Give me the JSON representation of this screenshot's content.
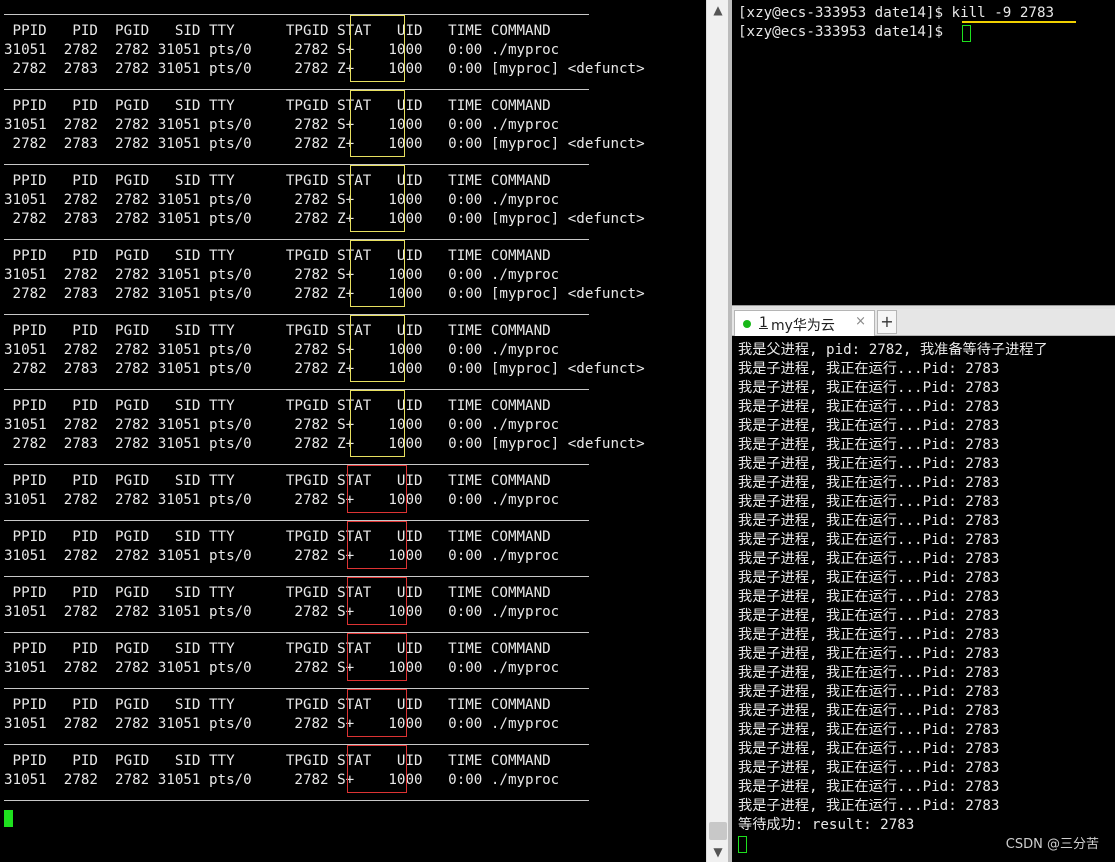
{
  "left_terminal": {
    "header": " PPID   PID  PGID   SID TTY      TPGID STAT   UID   TIME COMMAND",
    "blocks": [
      {
        "rows": [
          "31051  2782  2782 31051 pts/0     2782 S+    1000   0:00 ./myproc",
          " 2782  2783  2782 31051 pts/0     2782 Z+    1000   0:00 [myproc] <defunct>"
        ]
      },
      {
        "rows": [
          "31051  2782  2782 31051 pts/0     2782 S+    1000   0:00 ./myproc",
          " 2782  2783  2782 31051 pts/0     2782 Z+    1000   0:00 [myproc] <defunct>"
        ]
      },
      {
        "rows": [
          "31051  2782  2782 31051 pts/0     2782 S+    1000   0:00 ./myproc",
          " 2782  2783  2782 31051 pts/0     2782 Z+    1000   0:00 [myproc] <defunct>"
        ]
      },
      {
        "rows": [
          "31051  2782  2782 31051 pts/0     2782 S+    1000   0:00 ./myproc",
          " 2782  2783  2782 31051 pts/0     2782 Z+    1000   0:00 [myproc] <defunct>"
        ]
      },
      {
        "rows": [
          "31051  2782  2782 31051 pts/0     2782 S+    1000   0:00 ./myproc",
          " 2782  2783  2782 31051 pts/0     2782 Z+    1000   0:00 [myproc] <defunct>"
        ]
      },
      {
        "rows": [
          "31051  2782  2782 31051 pts/0     2782 S+    1000   0:00 ./myproc",
          " 2782  2783  2782 31051 pts/0     2782 Z+    1000   0:00 [myproc] <defunct>"
        ]
      },
      {
        "rows": [
          "31051  2782  2782 31051 pts/0     2782 S+    1000   0:00 ./myproc"
        ]
      },
      {
        "rows": [
          "31051  2782  2782 31051 pts/0     2782 S+    1000   0:00 ./myproc"
        ]
      },
      {
        "rows": [
          "31051  2782  2782 31051 pts/0     2782 S+    1000   0:00 ./myproc"
        ]
      },
      {
        "rows": [
          "31051  2782  2782 31051 pts/0     2782 S+    1000   0:00 ./myproc"
        ]
      },
      {
        "rows": [
          "31051  2782  2782 31051 pts/0     2782 S+    1000   0:00 ./myproc"
        ]
      },
      {
        "rows": [
          "31051  2782  2782 31051 pts/0     2782 S+    1000   0:00 ./myproc"
        ]
      }
    ]
  },
  "right_top_terminal": {
    "lines": [
      "[xzy@ecs-333953 date14]$ kill -9 2783",
      "[xzy@ecs-333953 date14]$ "
    ]
  },
  "tab": {
    "number": "1",
    "label": " my华为云",
    "close": "×",
    "add": "+"
  },
  "right_bottom_terminal": {
    "lines": [
      "我是父进程, pid: 2782, 我准备等待子进程了",
      "我是子进程, 我正在运行...Pid: 2783",
      "我是子进程, 我正在运行...Pid: 2783",
      "我是子进程, 我正在运行...Pid: 2783",
      "我是子进程, 我正在运行...Pid: 2783",
      "我是子进程, 我正在运行...Pid: 2783",
      "我是子进程, 我正在运行...Pid: 2783",
      "我是子进程, 我正在运行...Pid: 2783",
      "我是子进程, 我正在运行...Pid: 2783",
      "我是子进程, 我正在运行...Pid: 2783",
      "我是子进程, 我正在运行...Pid: 2783",
      "我是子进程, 我正在运行...Pid: 2783",
      "我是子进程, 我正在运行...Pid: 2783",
      "我是子进程, 我正在运行...Pid: 2783",
      "我是子进程, 我正在运行...Pid: 2783",
      "我是子进程, 我正在运行...Pid: 2783",
      "我是子进程, 我正在运行...Pid: 2783",
      "我是子进程, 我正在运行...Pid: 2783",
      "我是子进程, 我正在运行...Pid: 2783",
      "我是子进程, 我正在运行...Pid: 2783",
      "我是子进程, 我正在运行...Pid: 2783",
      "我是子进程, 我正在运行...Pid: 2783",
      "我是子进程, 我正在运行...Pid: 2783",
      "我是子进程, 我正在运行...Pid: 2783",
      "我是子进程, 我正在运行...Pid: 2783",
      "等待成功: result: 2783"
    ]
  },
  "watermark": "CSDN @三分苦",
  "scrollbar": {
    "up": "▲",
    "down": "▼"
  },
  "colors": {
    "background": "#000000",
    "text": "#e8e8e8",
    "cursor": "#1ee01e",
    "highlight_zombie": "#e8e060",
    "highlight_sleep": "#dd3333",
    "command_underline": "#f0d000"
  }
}
